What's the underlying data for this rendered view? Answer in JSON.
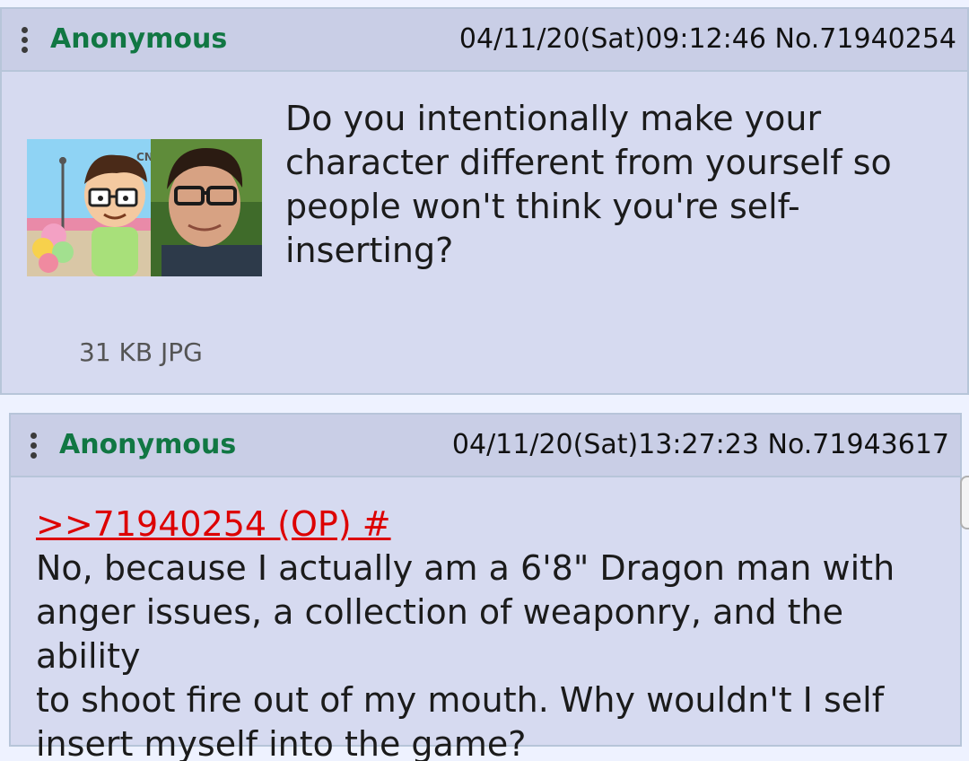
{
  "posts": [
    {
      "name": "Anonymous",
      "meta": "04/11/20(Sat)09:12:46 No.71940254",
      "body": "Do you intentionally make your\ncharacter different from yourself so\npeople won't think you're self-\ninserting?",
      "file_info": "31 KB JPG",
      "thumbnail": "cartoon-and-photo-thumbnail"
    },
    {
      "name": "Anonymous",
      "meta": "04/11/20(Sat)13:27:23 No.71943617",
      "quote": ">>71940254 (OP) #",
      "body": "No, because I actually am a 6'8\" Dragon man with\nanger issues, a collection of weaponry, and the ability\nto shoot fire out of my mouth. Why wouldn't I self\ninsert myself into the game?"
    }
  ],
  "colors": {
    "name": "#117743",
    "quote": "#dd0000",
    "post_bg": "#d6daf0",
    "header_bg": "#c9cee6"
  }
}
